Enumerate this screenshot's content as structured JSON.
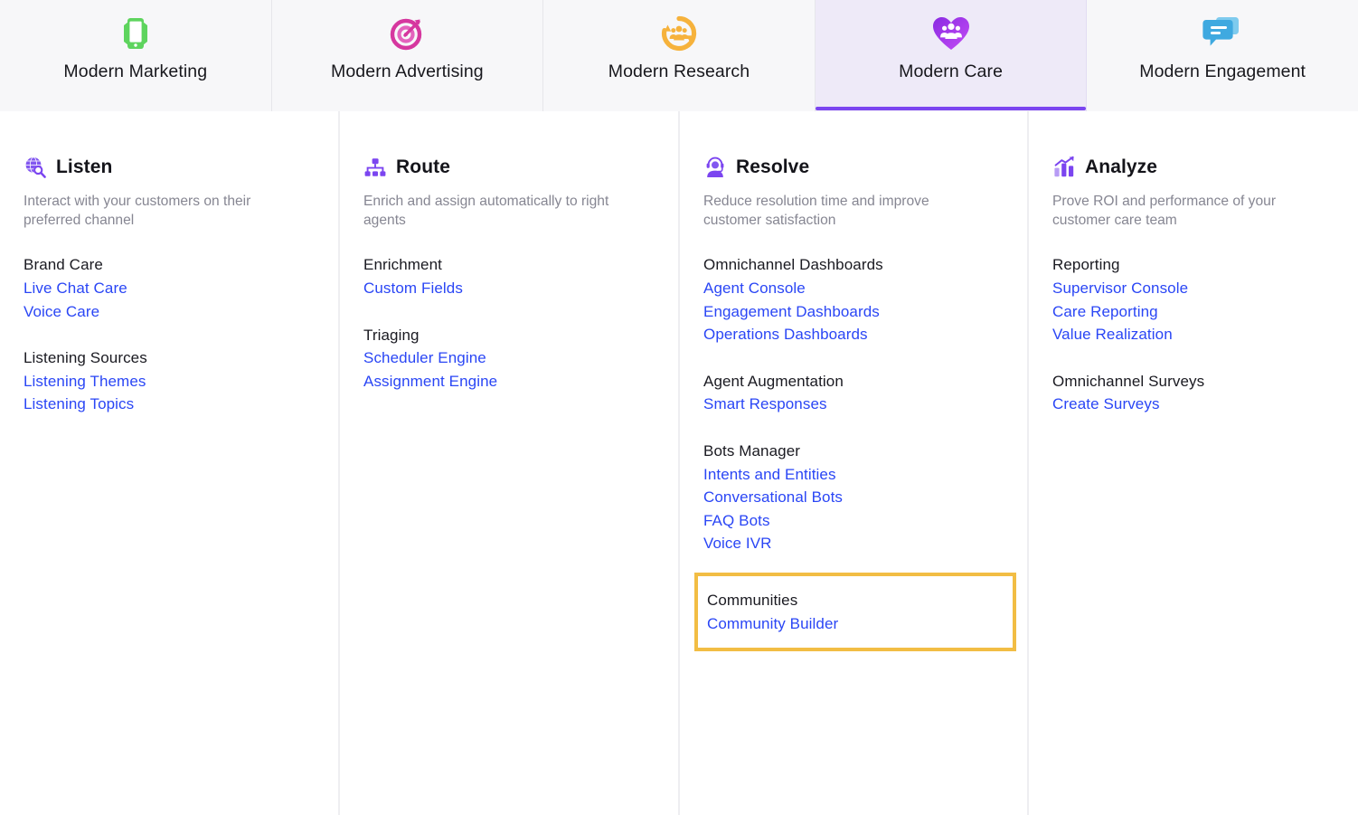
{
  "tabs": [
    {
      "label": "Modern Marketing",
      "icon": "mobile-phone-icon",
      "color": "#5ed45e",
      "active": false
    },
    {
      "label": "Modern Advertising",
      "icon": "target-arrow-icon",
      "color": "#d6379f",
      "active": false
    },
    {
      "label": "Modern Research",
      "icon": "people-cycle-icon",
      "color": "#f6b23c",
      "active": false
    },
    {
      "label": "Modern Care",
      "icon": "heart-people-icon",
      "color": "#9b3ff0",
      "active": true
    },
    {
      "label": "Modern Engagement",
      "icon": "chat-bubbles-icon",
      "color": "#4ab3ec",
      "active": false
    }
  ],
  "accent": {
    "active_tab_bg": "#eeeaf8",
    "active_tab_bar": "#7b45f0",
    "link": "#2a46f5",
    "highlight_border": "#f2bd44",
    "icon_purple": "#7b45f0"
  },
  "columns": [
    {
      "title": "Listen",
      "icon": "globe-search-icon",
      "description": "Interact with your customers on their preferred channel",
      "groups": [
        {
          "title": "Brand Care",
          "highlighted": false,
          "links": [
            "Live Chat Care",
            "Voice Care"
          ]
        },
        {
          "title": "Listening Sources",
          "highlighted": false,
          "links": [
            "Listening Themes",
            "Listening Topics"
          ]
        }
      ]
    },
    {
      "title": "Route",
      "icon": "hierarchy-icon",
      "description": "Enrich and assign automatically to right agents",
      "groups": [
        {
          "title": "Enrichment",
          "highlighted": false,
          "links": [
            "Custom Fields"
          ]
        },
        {
          "title": "Triaging",
          "highlighted": false,
          "links": [
            "Scheduler Engine",
            "Assignment Engine"
          ]
        }
      ]
    },
    {
      "title": "Resolve",
      "icon": "agent-headset-icon",
      "description": "Reduce resolution time and improve customer satisfaction",
      "groups": [
        {
          "title": "Omnichannel Dashboards",
          "highlighted": false,
          "links": [
            "Agent Console",
            "Engagement Dashboards",
            "Operations Dashboards"
          ]
        },
        {
          "title": "Agent Augmentation",
          "highlighted": false,
          "links": [
            "Smart Responses"
          ]
        },
        {
          "title": "Bots Manager",
          "highlighted": false,
          "links": [
            "Intents and Entities",
            "Conversational Bots",
            "FAQ Bots",
            "Voice IVR"
          ]
        },
        {
          "title": "Communities",
          "highlighted": true,
          "links": [
            "Community Builder"
          ]
        }
      ]
    },
    {
      "title": "Analyze",
      "icon": "bar-chart-trend-icon",
      "description": "Prove ROI and performance of your customer care team",
      "groups": [
        {
          "title": "Reporting",
          "highlighted": false,
          "links": [
            "Supervisor Console",
            "Care Reporting",
            "Value Realization"
          ]
        },
        {
          "title": "Omnichannel Surveys",
          "highlighted": false,
          "links": [
            "Create Surveys"
          ]
        }
      ]
    }
  ]
}
